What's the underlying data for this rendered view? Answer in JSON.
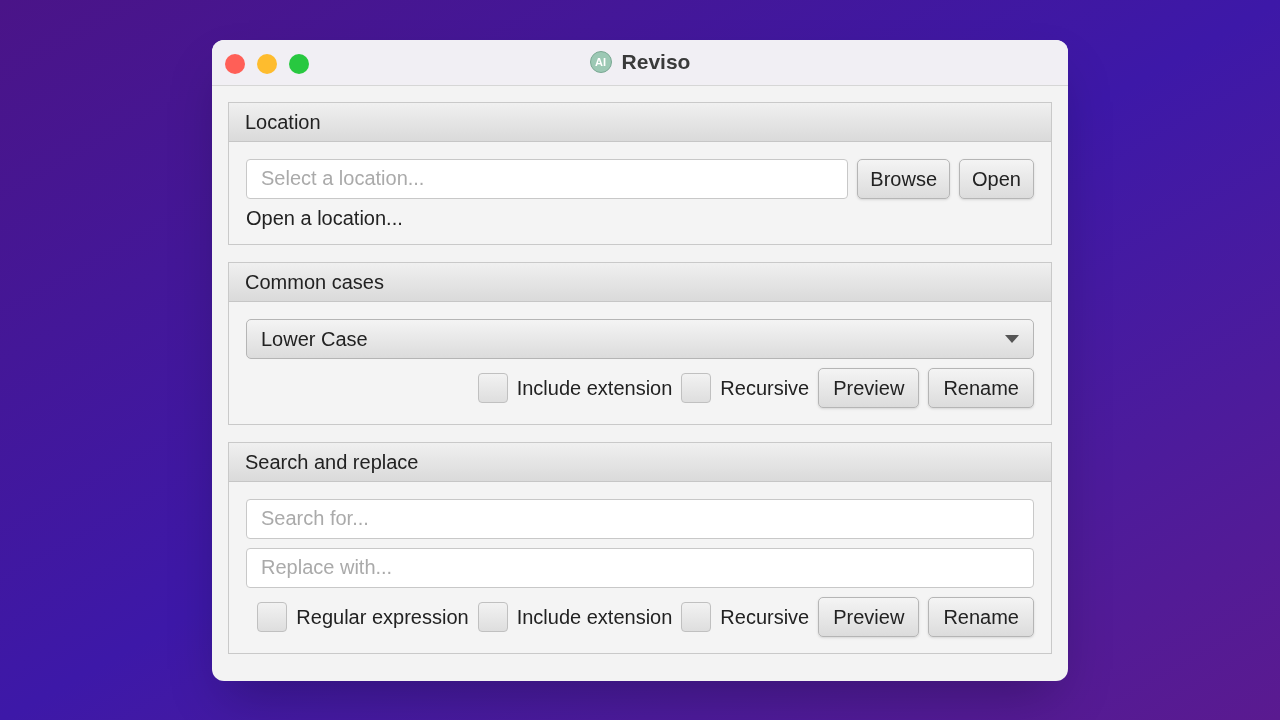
{
  "window": {
    "title": "Reviso",
    "icon_text": "AI"
  },
  "sections": [
    {
      "title": "Location",
      "rows": [
        {
          "kind": "field-buttons",
          "placeholder": "Select a location...",
          "buttons": [
            "Browse",
            "Open"
          ]
        },
        {
          "kind": "text",
          "text": "Open a location..."
        }
      ]
    },
    {
      "title": "Common cases",
      "rows": [
        {
          "kind": "dropdown",
          "value": "Lower Case"
        },
        {
          "kind": "options",
          "checkboxes": [
            {
              "label": "Include extension",
              "checked": false
            },
            {
              "label": "Recursive",
              "checked": false
            }
          ],
          "buttons": [
            "Preview",
            "Rename"
          ]
        }
      ]
    },
    {
      "title": "Search and replace",
      "rows": [
        {
          "kind": "field",
          "placeholder": "Search for..."
        },
        {
          "kind": "field",
          "placeholder": "Replace with..."
        },
        {
          "kind": "options",
          "checkboxes": [
            {
              "label": "Regular expression",
              "checked": false
            },
            {
              "label": "Include extension",
              "checked": false
            },
            {
              "label": "Recursive",
              "checked": false
            }
          ],
          "buttons": [
            "Preview",
            "Rename"
          ]
        }
      ]
    }
  ]
}
